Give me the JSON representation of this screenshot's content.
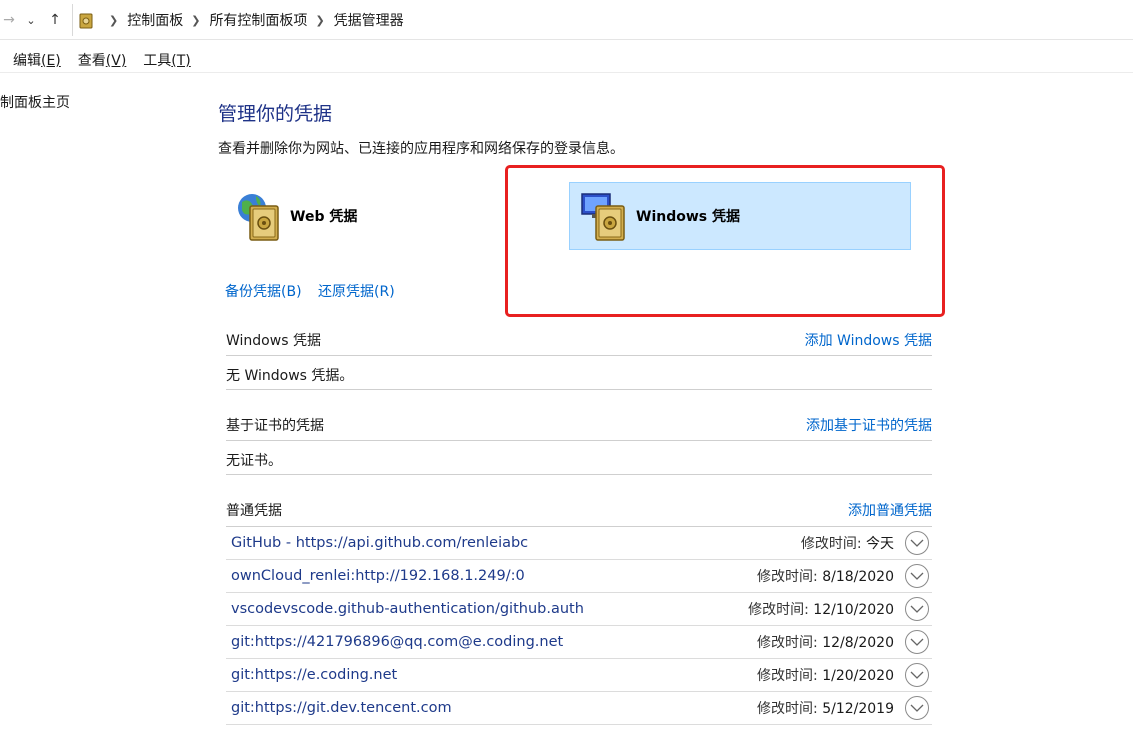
{
  "addressbar": {
    "crumbs": [
      "控制面板",
      "所有控制面板项",
      "凭据管理器"
    ]
  },
  "menu": {
    "edit": "编辑",
    "edit_key": "(E)",
    "view": "查看",
    "view_key": "(V)",
    "tools": "工具",
    "tools_key": "(T)"
  },
  "sidebar": {
    "home_link": "制面板主页"
  },
  "main": {
    "title": "管理你的凭据",
    "subtitle": "查看并删除你为网站、已连接的应用程序和网络保存的登录信息。",
    "tile_web": "Web 凭据",
    "tile_windows": "Windows 凭据",
    "backup": "备份凭据(B)",
    "restore": "还原凭据(R)"
  },
  "sections": {
    "windows": {
      "title": "Windows 凭据",
      "action": "添加 Windows 凭据",
      "empty": "无 Windows 凭据。"
    },
    "cert": {
      "title": "基于证书的凭据",
      "action": "添加基于证书的凭据",
      "empty": "无证书。"
    },
    "generic": {
      "title": "普通凭据",
      "action": "添加普通凭据"
    }
  },
  "credentials": [
    {
      "name": "GitHub - https://api.github.com/renleiabc",
      "label": "修改时间:",
      "date": "今天"
    },
    {
      "name": "ownCloud_renlei:http://192.168.1.249/:0",
      "label": "修改时间:",
      "date": "8/18/2020"
    },
    {
      "name": "vscodevscode.github-authentication/github.auth",
      "label": "修改时间:",
      "date": "12/10/2020"
    },
    {
      "name": "git:https://421796896@qq.com@e.coding.net",
      "label": "修改时间:",
      "date": "12/8/2020"
    },
    {
      "name": "git:https://e.coding.net",
      "label": "修改时间:",
      "date": "1/20/2020"
    },
    {
      "name": "git:https://git.dev.tencent.com",
      "label": "修改时间:",
      "date": "5/12/2019"
    }
  ],
  "colors": {
    "accent": "#0066cc",
    "title": "#1e3287",
    "highlight": "#cce8ff",
    "annotation": "#e82020"
  }
}
